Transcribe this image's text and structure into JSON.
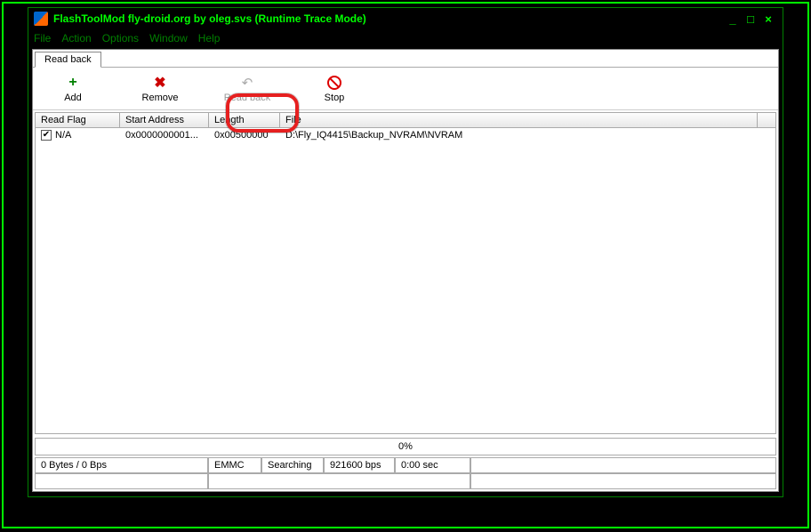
{
  "window": {
    "title": "FlashToolMod fly-droid.org by oleg.svs (Runtime Trace Mode)"
  },
  "menubar": {
    "file": "File",
    "action": "Action",
    "options": "Options",
    "window": "Window",
    "help": "Help"
  },
  "tab": {
    "readback": "Read back"
  },
  "toolbar": {
    "add": "Add",
    "remove": "Remove",
    "readback": "Read back",
    "stop": "Stop"
  },
  "table": {
    "headers": {
      "flag": "Read Flag",
      "start": "Start Address",
      "length": "Length",
      "file": "File"
    },
    "row0": {
      "checked": "✔",
      "flag": "N/A",
      "start": "0x0000000001...",
      "length": "0x00500000",
      "file": "D:\\Fly_IQ4415\\Backup_NVRAM\\NVRAM"
    }
  },
  "progress": {
    "text": "0%"
  },
  "status": {
    "bytes": "0 Bytes / 0 Bps",
    "storage": "EMMC",
    "state": "Searching",
    "baud": "921600 bps",
    "time": "0:00 sec"
  }
}
